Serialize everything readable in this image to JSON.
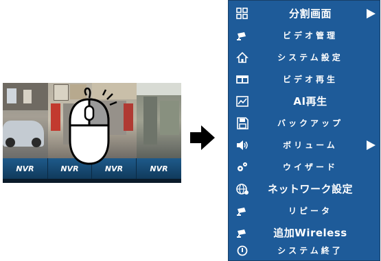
{
  "preview": {
    "tiles": [
      "NVR",
      "NVR",
      "NVR",
      "NVR"
    ],
    "tile_color": "#1a4f7c"
  },
  "arrow_color": "#000000",
  "menu": {
    "background": "#1e5b99",
    "text_color": "#ffffff",
    "items": [
      {
        "label": "分割画面",
        "icon": "grid-icon",
        "submenu": true
      },
      {
        "label": "ビデオ管理",
        "icon": "camera-icon",
        "submenu": false
      },
      {
        "label": "システム設定",
        "icon": "home-icon",
        "submenu": false
      },
      {
        "label": "ビデオ再生",
        "icon": "film-icon",
        "submenu": false
      },
      {
        "label": "AI再生",
        "icon": "chart-icon",
        "submenu": false
      },
      {
        "label": "バックアップ",
        "icon": "floppy-icon",
        "submenu": false
      },
      {
        "label": "ボリューム",
        "icon": "speaker-icon",
        "submenu": true
      },
      {
        "label": "ウイザード",
        "icon": "gears-icon",
        "submenu": false
      },
      {
        "label": "ネットワーク設定",
        "icon": "globe-icon",
        "submenu": false
      },
      {
        "label": "リピータ",
        "icon": "camera-icon",
        "submenu": false
      },
      {
        "label": "追加Wireless",
        "icon": "camera-icon",
        "submenu": false
      },
      {
        "label": "システム終了",
        "icon": "power-icon",
        "submenu": false
      }
    ]
  }
}
